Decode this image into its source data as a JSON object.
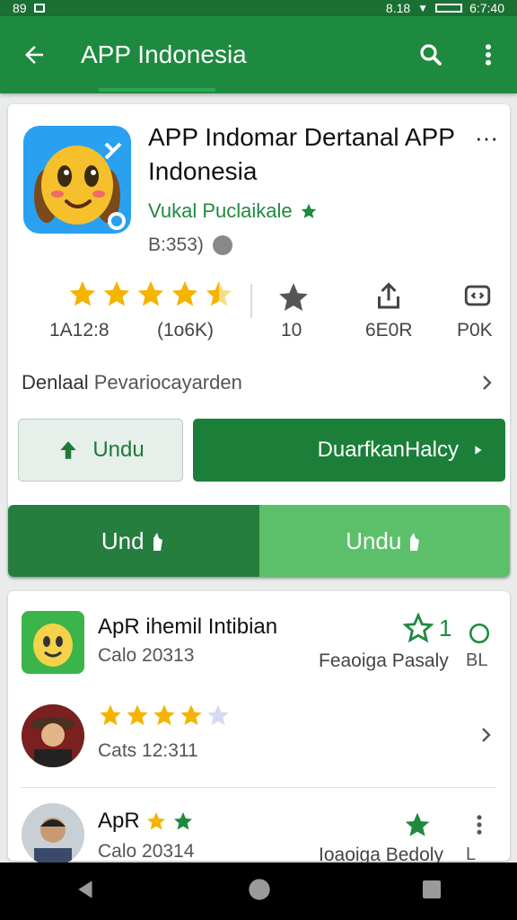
{
  "status_bar": {
    "left_text": "89",
    "right_text": "8.18",
    "time": "6:7:40"
  },
  "app_bar": {
    "title": "APP Indonesia",
    "back_icon": "back-arrow-icon",
    "search_icon": "search-icon",
    "menu_icon": "more-vert-icon"
  },
  "app": {
    "title": "APP Indomar Dertanal APP Indonesia",
    "developer": "Vukal Puclaikale",
    "rating_count": "B:353)"
  },
  "stats": {
    "rating_value": "1A12:8",
    "reviews": "(1o6K)",
    "downloads": "10",
    "share_label": "6E0R",
    "other_label": "P0K",
    "stars": 4.5
  },
  "description": {
    "label": "Denlaal",
    "text": "Pevariocayarden"
  },
  "buttons": {
    "light": "Undu",
    "dark": "DuarfkanHalcy",
    "split_left": "Und",
    "split_right": "Undu"
  },
  "list": [
    {
      "title": "ApR ihemil Intibian",
      "subtitle": "Calo 20313",
      "right_text": "Feaoiga Pasaly",
      "right_text2": "BL",
      "badge": "1"
    },
    {
      "title": "",
      "subtitle": "Cats 12:311",
      "stars": 4
    },
    {
      "title": "ApR",
      "subtitle": "Calo 20314",
      "right_text": "Ioaoiga Bedoly",
      "right_text2": "L"
    }
  ],
  "colors": {
    "primary": "#1e8a3f",
    "primary_dark": "#1a6f33",
    "accent": "#5cc06a",
    "star": "#f4b400"
  }
}
